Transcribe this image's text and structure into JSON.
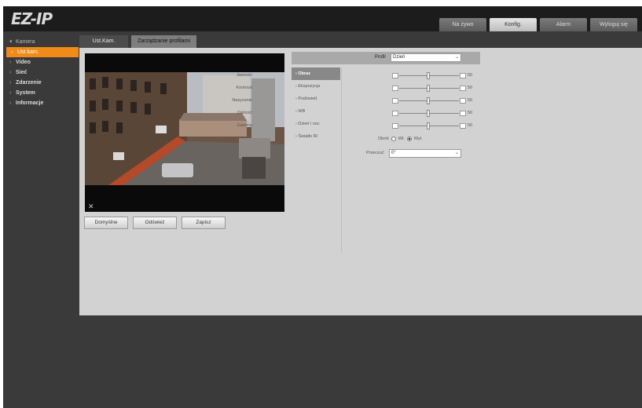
{
  "logo": "EZ-IP",
  "top_tabs": [
    {
      "label": "Na żywo",
      "active": false
    },
    {
      "label": "Konfig.",
      "active": true
    },
    {
      "label": "Alarm",
      "active": false
    },
    {
      "label": "Wyloguj się",
      "active": false
    }
  ],
  "sidebar": {
    "items": [
      {
        "label": "Kamera",
        "type": "top",
        "arrow": "▾"
      },
      {
        "label": "Ust.kam.",
        "type": "selected",
        "arrow": "›"
      },
      {
        "label": "Video",
        "type": "sub",
        "arrow": "›"
      },
      {
        "label": "Sieć",
        "type": "sub",
        "arrow": "›"
      },
      {
        "label": "Zdarzenie",
        "type": "sub",
        "arrow": "›"
      },
      {
        "label": "System",
        "type": "sub",
        "arrow": "›"
      },
      {
        "label": "Informacje",
        "type": "sub",
        "arrow": "›"
      }
    ]
  },
  "sub_tabs": [
    {
      "label": "Ust.Kam.",
      "active": true
    },
    {
      "label": "Zarządzanie profilami",
      "active": false
    }
  ],
  "buttons": {
    "default": "Domyślne",
    "refresh": "Odśwież",
    "save": "Zapisz"
  },
  "profile": {
    "label": "Profil",
    "value": "Dzień"
  },
  "menu": [
    {
      "label": "Obraz",
      "active": true
    },
    {
      "label": "Ekspozycja",
      "active": false
    },
    {
      "label": "Podświetl.",
      "active": false
    },
    {
      "label": "WB",
      "active": false
    },
    {
      "label": "Dzień i noc",
      "active": false
    },
    {
      "label": "Światło IR",
      "active": false
    }
  ],
  "sliders": [
    {
      "label": "Jasność",
      "value": "50"
    },
    {
      "label": "Kontrast",
      "value": "50"
    },
    {
      "label": "Nasycenie",
      "value": "50"
    },
    {
      "label": "Ostrość",
      "value": "50"
    },
    {
      "label": "Gamma",
      "value": "50"
    }
  ],
  "mirror": {
    "label": "Obrót",
    "options": [
      {
        "label": "Wł.",
        "checked": false
      },
      {
        "label": "Wył.",
        "checked": true
      }
    ]
  },
  "rotate": {
    "label": "Przeczuć",
    "value": "0°"
  },
  "colors": {
    "accent": "#f08a18",
    "background": "#3a3a3a",
    "panel": "#d2d2d2"
  }
}
